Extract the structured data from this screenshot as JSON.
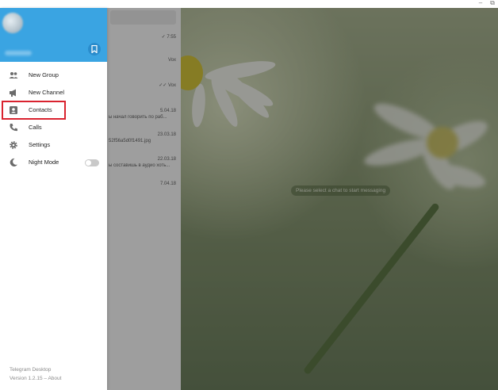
{
  "window": {
    "minimize_glyph": "‒",
    "maximize_glyph": "⧉"
  },
  "drawer": {
    "menu": [
      {
        "label": "New Group",
        "icon": "group-icon"
      },
      {
        "label": "New Channel",
        "icon": "megaphone-icon"
      },
      {
        "label": "Contacts",
        "icon": "contact-card-icon"
      },
      {
        "label": "Calls",
        "icon": "phone-icon"
      },
      {
        "label": "Settings",
        "icon": "gear-icon"
      },
      {
        "label": "Night Mode",
        "icon": "moon-icon",
        "toggle": "off"
      }
    ],
    "footer": {
      "app_name": "Telegram Desktop",
      "version": "Version 1.2.15",
      "separator": " – ",
      "about": "About"
    }
  },
  "chat_list": {
    "rows": [
      {
        "time": "✓ 7:55",
        "snippet": ""
      },
      {
        "time": "Vox",
        "snippet": ""
      },
      {
        "time": "✓✓ Vox",
        "snippet": ""
      },
      {
        "time": "5.04.18",
        "snippet": "ы начал говорить по раб..."
      },
      {
        "time": "23.03.18",
        "snippet": "52f56a5d0f1491.jpg"
      },
      {
        "time": "22.03.18",
        "snippet": "ы составишь в аудио хоть..."
      },
      {
        "time": "7.04.18",
        "snippet": ""
      }
    ]
  },
  "chat_area": {
    "placeholder": "Please select a chat to start messaging"
  },
  "colors": {
    "header_blue": "#3aa4e2",
    "highlight_red": "#d9232f",
    "icon_gray": "#6b6b6b"
  }
}
